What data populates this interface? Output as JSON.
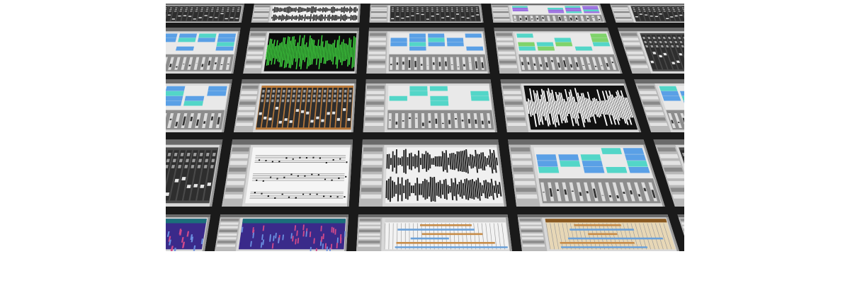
{
  "scene": {
    "subject": "daw-screen-collage",
    "palette": {
      "background": "#1a1a1a",
      "panel": "#d8d8d8",
      "panel_dark": "#4a4a4a",
      "waveform_green": "#3ecf3e",
      "clip_blue": "#5aa0e6",
      "clip_cyan": "#53d6c8",
      "clip_purple": "#9a6fe0",
      "clip_green": "#7fd36b",
      "wood": "#b9793a",
      "score_white": "#f5f5f5",
      "spectrum": "#3a2a8a"
    },
    "tiles": [
      {
        "kind": "mixer"
      },
      {
        "kind": "waveform-dark"
      },
      {
        "kind": "mixer"
      },
      {
        "kind": "clips-purple"
      },
      {
        "kind": "mixer"
      },
      {
        "kind": "clips"
      },
      {
        "kind": "waveform-green"
      },
      {
        "kind": "clips"
      },
      {
        "kind": "clips-green"
      },
      {
        "kind": "mixer"
      },
      {
        "kind": "clips"
      },
      {
        "kind": "mixer-wood"
      },
      {
        "kind": "clips-cyan"
      },
      {
        "kind": "waveform-white"
      },
      {
        "kind": "clips"
      },
      {
        "kind": "mixer"
      },
      {
        "kind": "score"
      },
      {
        "kind": "waveform-dark"
      },
      {
        "kind": "clips"
      },
      {
        "kind": "mixer"
      },
      {
        "kind": "spectrum"
      },
      {
        "kind": "spectrum"
      },
      {
        "kind": "timeline"
      },
      {
        "kind": "timeline-wood"
      },
      {
        "kind": "mixer"
      }
    ]
  }
}
